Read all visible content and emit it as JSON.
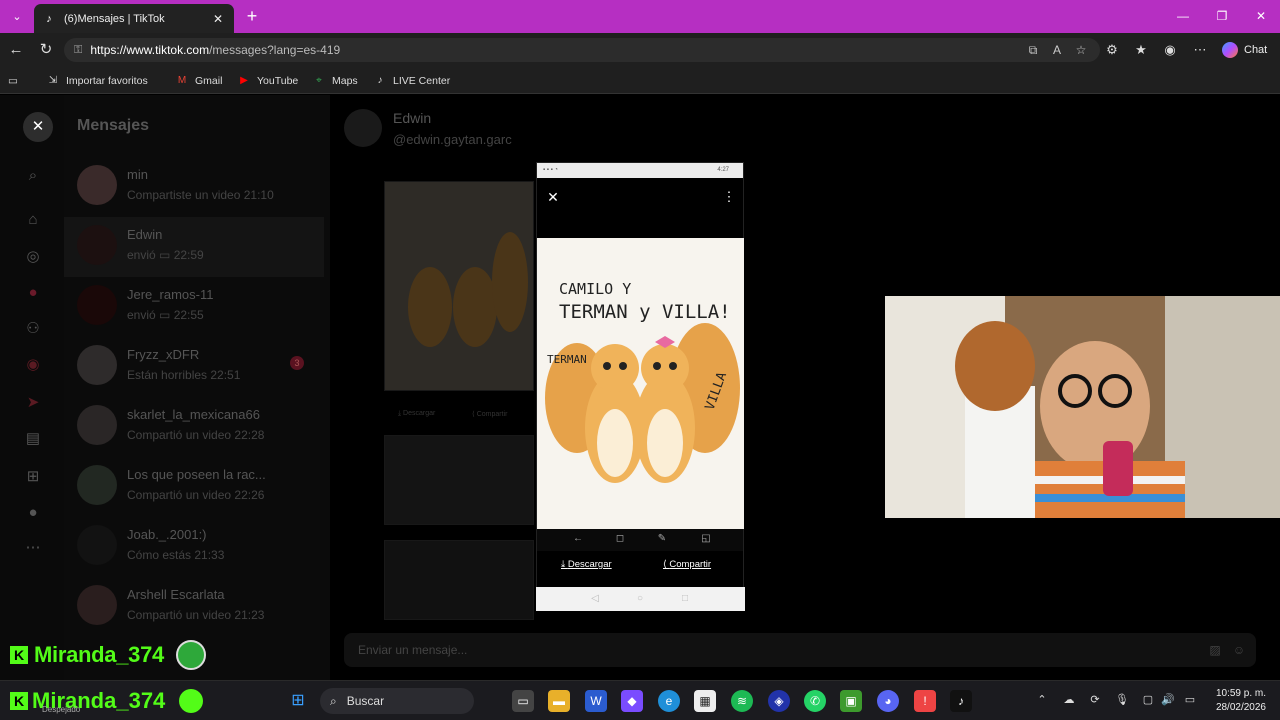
{
  "browser": {
    "tab_title": "(6)Mensajes | TikTok",
    "url_host": "https://www.tiktok.com",
    "url_path": "/messages?lang=es-419",
    "chat_label": "Chat"
  },
  "bookmarks": [
    {
      "label": "Importar favoritos",
      "icon": "import-icon"
    },
    {
      "label": "Gmail",
      "icon": "gmail-icon"
    },
    {
      "label": "YouTube",
      "icon": "youtube-icon"
    },
    {
      "label": "Maps",
      "icon": "maps-icon"
    },
    {
      "label": "LIVE Center",
      "icon": "tiktok-icon"
    }
  ],
  "messages": {
    "title": "Mensajes",
    "conversations": [
      {
        "name": "min",
        "preview": "Compartiste un video 21:10"
      },
      {
        "name": "Edwin",
        "preview": "envió ▭ 22:59",
        "active": true
      },
      {
        "name": "Jere_ramos-11",
        "preview": "envió ▭ 22:55"
      },
      {
        "name": "Fryzz_xDFR",
        "preview": "Están horribles 22:51",
        "badge": "3"
      },
      {
        "name": "skarlet_la_mexicana66",
        "preview": "Compartió un video 22:28"
      },
      {
        "name": "Los que poseen la rac...",
        "preview": "Compartió un video 22:26"
      },
      {
        "name": "Joab._.2001:)",
        "preview": "Cómo estás 21:33"
      },
      {
        "name": "Arshell Escarlata",
        "preview": "Compartió un video 21:23"
      }
    ]
  },
  "chat": {
    "name": "Edwin",
    "handle": "@edwin.gaytan.garc",
    "input_placeholder": "Enviar un mensaje...",
    "thumb_actions": {
      "download": "Descargar",
      "share": "Compartir"
    }
  },
  "phone": {
    "status_time": "4:27",
    "artwork_lines": [
      "CAMILO Y",
      "TERMAN y VILLA!"
    ],
    "artwork_tags": [
      "TERMAN",
      "VILLA"
    ],
    "download_label": "Descargar",
    "share_label": "Compartir"
  },
  "overlay": {
    "username": "Miranda_374"
  },
  "taskbar": {
    "search_label": "Buscar",
    "weather": "Despejado",
    "time": "10:59 p. m.",
    "date": "28/02/2026"
  }
}
